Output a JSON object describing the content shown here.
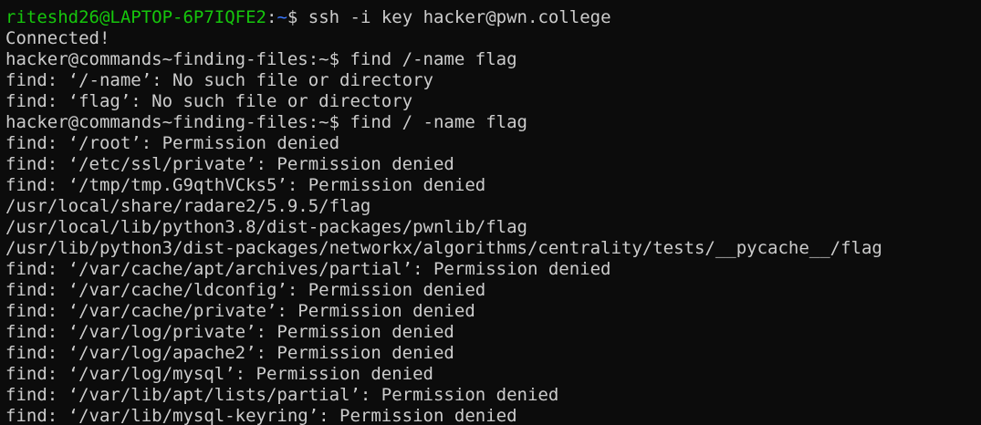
{
  "terminal": {
    "local_prompt": {
      "user_host": "riteshd26@LAPTOP-6P7IQFE2",
      "separator": ":",
      "path": "~",
      "symbol": "$ ",
      "command": "ssh -i key hacker@pwn.college"
    },
    "lines": [
      "Connected!",
      "hacker@commands~finding-files:~$ find /-name flag",
      "find: ‘/-name’: No such file or directory",
      "find: ‘flag’: No such file or directory",
      "hacker@commands~finding-files:~$ find / -name flag",
      "find: ‘/root’: Permission denied",
      "find: ‘/etc/ssl/private’: Permission denied",
      "find: ‘/tmp/tmp.G9qthVCks5’: Permission denied",
      "/usr/local/share/radare2/5.9.5/flag",
      "/usr/local/lib/python3.8/dist-packages/pwnlib/flag",
      "/usr/lib/python3/dist-packages/networkx/algorithms/centrality/tests/__pycache__/flag",
      "find: ‘/var/cache/apt/archives/partial’: Permission denied",
      "find: ‘/var/cache/ldconfig’: Permission denied",
      "find: ‘/var/cache/private’: Permission denied",
      "find: ‘/var/log/private’: Permission denied",
      "find: ‘/var/log/apache2’: Permission denied",
      "find: ‘/var/log/mysql’: Permission denied",
      "find: ‘/var/lib/apt/lists/partial’: Permission denied",
      "find: ‘/var/lib/mysql-keyring’: Permission denied"
    ]
  },
  "colors": {
    "background": "#0c0c0c",
    "foreground": "#cccccc",
    "prompt_user": "#16c60c",
    "prompt_path": "#3b78ff"
  }
}
